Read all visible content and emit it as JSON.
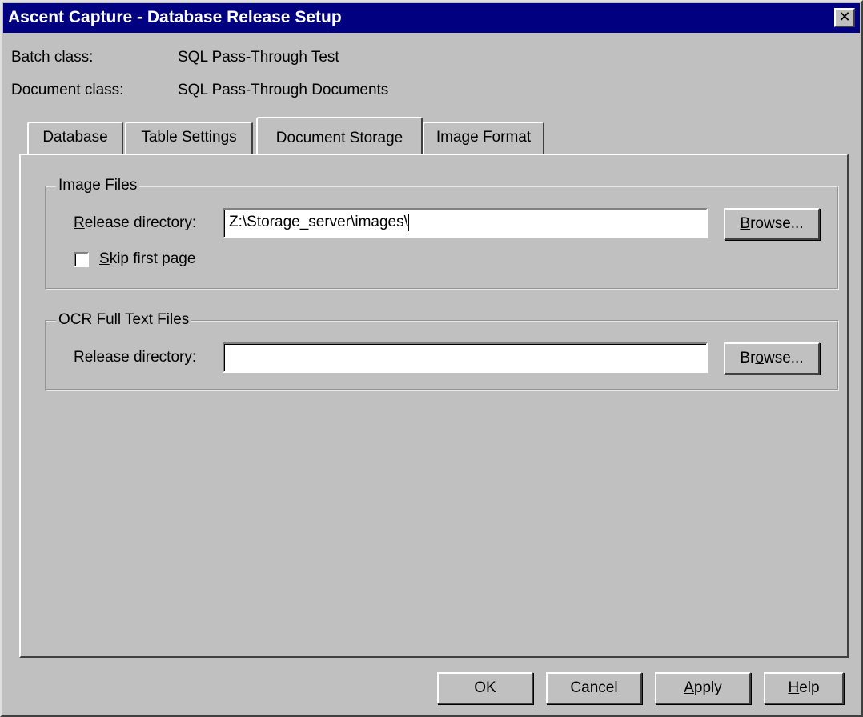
{
  "window": {
    "title": "Ascent Capture - Database Release Setup",
    "close_glyph": "✕"
  },
  "info": {
    "batch_class_label": "Batch class:",
    "batch_class_value": "SQL Pass-Through Test",
    "document_class_label": "Document class:",
    "document_class_value": "SQL Pass-Through Documents"
  },
  "tabs": [
    {
      "label": "Database",
      "active": false
    },
    {
      "label": "Table Settings",
      "active": false
    },
    {
      "label": "Document Storage",
      "active": true
    },
    {
      "label": "Image Format",
      "active": false
    }
  ],
  "image_files": {
    "group_label": "Image Files",
    "release_label_mnemonic": "R",
    "release_label_rest": "elease directory:",
    "release_value": "Z:\\Storage_server\\images\\",
    "browse_mnemonic": "B",
    "browse_rest": "rowse...",
    "skip_mnemonic": "S",
    "skip_rest": "kip first page",
    "skip_checked": false
  },
  "ocr_files": {
    "group_label": "OCR Full Text Files",
    "release_label_pre": "Release dire",
    "release_label_mnemonic": "c",
    "release_label_post": "tory:",
    "release_value": "",
    "browse_pre": "Br",
    "browse_mnemonic": "o",
    "browse_post": "wse..."
  },
  "buttons": {
    "ok": "OK",
    "cancel": "Cancel",
    "apply_mnemonic": "A",
    "apply_rest": "pply",
    "help_mnemonic": "H",
    "help_rest": "elp"
  },
  "colors": {
    "titlebar": "#000080",
    "face": "#c0c0c0"
  }
}
